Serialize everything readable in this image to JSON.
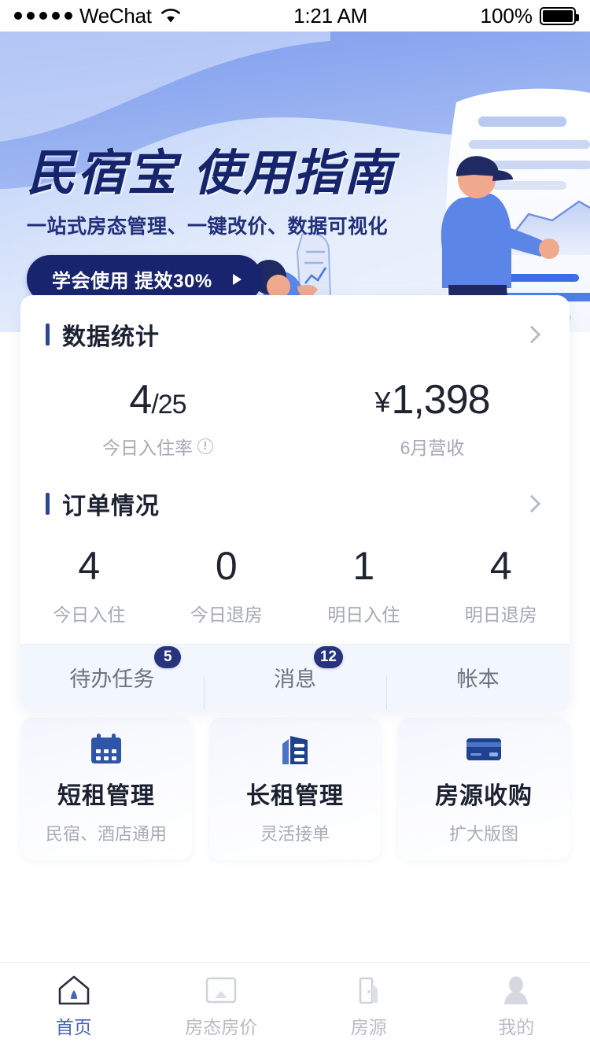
{
  "status_bar": {
    "carrier": "WeChat",
    "time": "1:21 AM",
    "battery": "100%",
    "signal_dots": 5,
    "wifi_icon": "wifi-icon",
    "battery_icon": "battery-full-icon"
  },
  "banner": {
    "title": "民宿宝 使用指南",
    "subtitle": "一站式房态管理、一键改价、数据可视化",
    "cta_label": "学会使用 提效30%",
    "cta_icon": "play-triangle-icon",
    "illustration": "person-holding-document-illustration",
    "bg_color_top": "#6f93e8",
    "bg_color_bottom": "#e3ecfb",
    "title_color": "#16246b",
    "cta_bg": "#18246e"
  },
  "stats_section": {
    "title": "数据统计",
    "chevron": "chevron-right-icon",
    "items": [
      {
        "value_main": "4",
        "value_suffix": "/25",
        "label": "今日入住率",
        "has_info": true
      },
      {
        "value_prefix": "¥",
        "value_main": "1,398",
        "label": "6月营收",
        "has_info": false
      }
    ]
  },
  "orders_section": {
    "title": "订单情况",
    "chevron": "chevron-right-icon",
    "items": [
      {
        "value": "4",
        "label": "今日入住"
      },
      {
        "value": "0",
        "label": "今日退房"
      },
      {
        "value": "1",
        "label": "明日入住"
      },
      {
        "value": "4",
        "label": "明日退房"
      }
    ]
  },
  "quick_tabs": [
    {
      "label": "待办任务",
      "badge": "5"
    },
    {
      "label": "消息",
      "badge": "12"
    },
    {
      "label": "帐本",
      "badge": ""
    }
  ],
  "feature_cards": [
    {
      "icon": "calendar-icon",
      "title": "短租管理",
      "subtitle": "民宿、酒店通用"
    },
    {
      "icon": "building-icon",
      "title": "长租管理",
      "subtitle": "灵活接单"
    },
    {
      "icon": "credit-card-icon",
      "title": "房源收购",
      "subtitle": "扩大版图"
    }
  ],
  "bottom_nav": [
    {
      "icon": "home-icon",
      "label": "首页",
      "active": true
    },
    {
      "icon": "calendar-price-icon",
      "label": "房态房价",
      "active": false
    },
    {
      "icon": "door-icon",
      "label": "房源",
      "active": false
    },
    {
      "icon": "person-icon",
      "label": "我的",
      "active": false
    }
  ],
  "theme": {
    "accent": "#2c4694",
    "badge_bg": "#27347d",
    "nav_active": "#4a63b5",
    "muted_text": "#a6a9b4"
  }
}
